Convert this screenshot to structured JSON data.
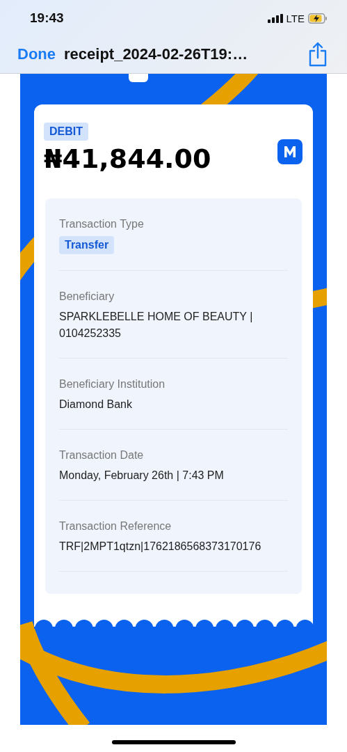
{
  "status_bar": {
    "time": "19:43",
    "network": "LTE"
  },
  "nav": {
    "done": "Done",
    "title": "receipt_2024-02-26T19:…"
  },
  "receipt": {
    "direction": "DEBIT",
    "amount": "₦41,844.00",
    "fields": [
      {
        "label": "Transaction Type",
        "value": "Transfer",
        "kind": "tag"
      },
      {
        "label": "Beneficiary",
        "value": "SPARKLEBELLE HOME OF BEAUTY | 0104252335",
        "kind": "text"
      },
      {
        "label": "Beneficiary Institution",
        "value": "Diamond Bank",
        "kind": "text"
      },
      {
        "label": "Transaction Date",
        "value": "Monday, February 26th | 7:43 PM",
        "kind": "text"
      },
      {
        "label": "Transaction Reference",
        "value": "TRF|2MPT1qtzn|1762186568373170176",
        "kind": "text"
      }
    ]
  }
}
